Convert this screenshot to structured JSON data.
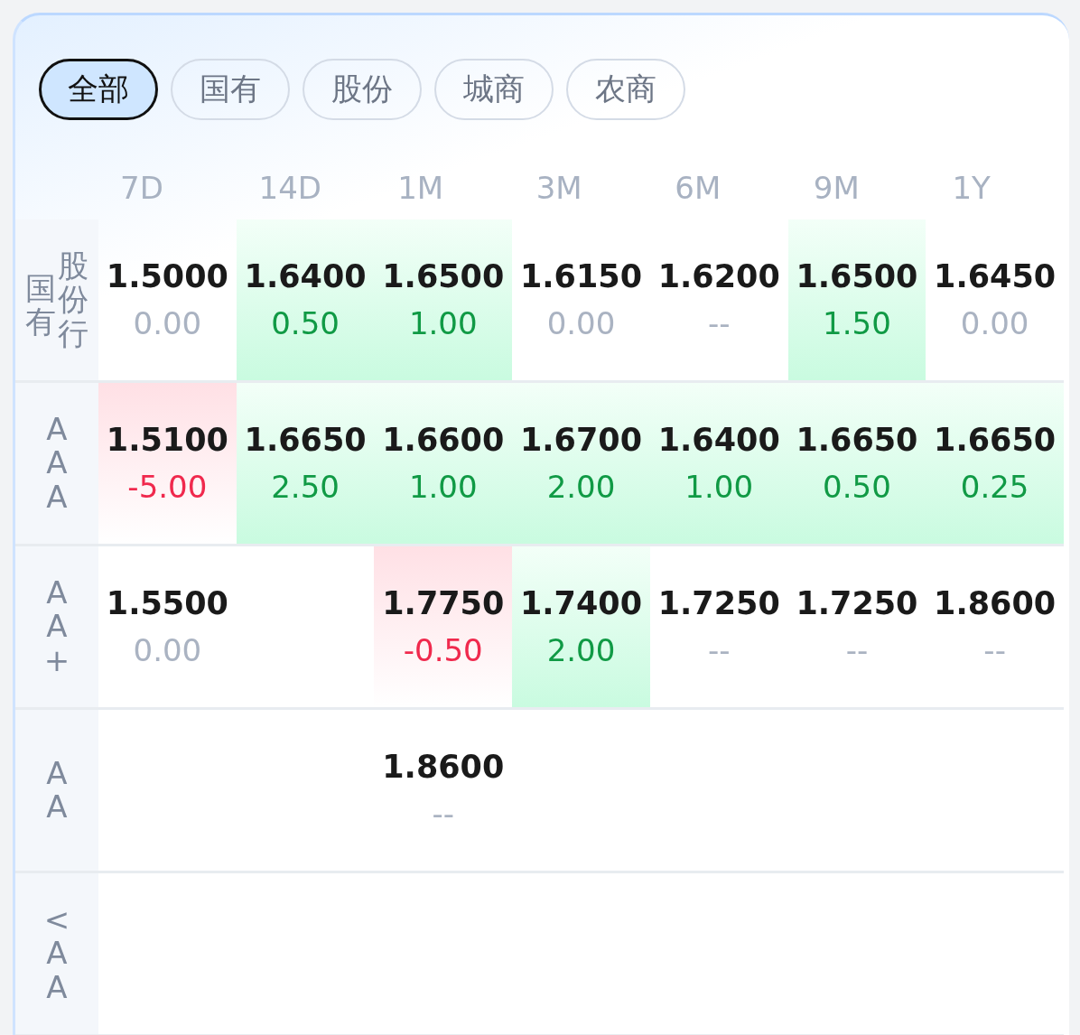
{
  "filters": [
    {
      "label": "全部",
      "selected": true
    },
    {
      "label": "国有",
      "selected": false
    },
    {
      "label": "股份",
      "selected": false
    },
    {
      "label": "城商",
      "selected": false
    },
    {
      "label": "农商",
      "selected": false
    }
  ],
  "columns": [
    "7D",
    "14D",
    "1M",
    "3M",
    "6M",
    "9M",
    "1Y"
  ],
  "rows": [
    {
      "label": [
        "国有",
        "股份行"
      ],
      "cells": [
        {
          "value": "1.5000",
          "change": "0.00",
          "up": false,
          "down": false
        },
        {
          "value": "1.6400",
          "change": "0.50",
          "up": true,
          "down": false
        },
        {
          "value": "1.6500",
          "change": "1.00",
          "up": true,
          "down": false
        },
        {
          "value": "1.6150",
          "change": "0.00",
          "up": false,
          "down": false
        },
        {
          "value": "1.6200",
          "change": "--",
          "up": false,
          "down": false
        },
        {
          "value": "1.6500",
          "change": "1.50",
          "up": true,
          "down": false
        },
        {
          "value": "1.6450",
          "change": "0.00",
          "up": false,
          "down": false
        }
      ]
    },
    {
      "label": [
        "AAA"
      ],
      "cells": [
        {
          "value": "1.5100",
          "change": "-5.00",
          "up": false,
          "down": true
        },
        {
          "value": "1.6650",
          "change": "2.50",
          "up": true,
          "down": false
        },
        {
          "value": "1.6600",
          "change": "1.00",
          "up": true,
          "down": false
        },
        {
          "value": "1.6700",
          "change": "2.00",
          "up": true,
          "down": false
        },
        {
          "value": "1.6400",
          "change": "1.00",
          "up": true,
          "down": false
        },
        {
          "value": "1.6650",
          "change": "0.50",
          "up": true,
          "down": false
        },
        {
          "value": "1.6650",
          "change": "0.25",
          "up": true,
          "down": false
        }
      ]
    },
    {
      "label": [
        "AA+"
      ],
      "cells": [
        {
          "value": "1.5500",
          "change": "0.00",
          "up": false,
          "down": false
        },
        null,
        {
          "value": "1.7750",
          "change": "-0.50",
          "up": false,
          "down": true
        },
        {
          "value": "1.7400",
          "change": "2.00",
          "up": true,
          "down": false
        },
        {
          "value": "1.7250",
          "change": "--",
          "up": false,
          "down": false
        },
        {
          "value": "1.7250",
          "change": "--",
          "up": false,
          "down": false
        },
        {
          "value": "1.8600",
          "change": "--",
          "up": false,
          "down": false
        }
      ]
    },
    {
      "label": [
        "AA"
      ],
      "cells": [
        null,
        null,
        {
          "value": "1.8600",
          "change": "--",
          "up": false,
          "down": false
        },
        null,
        null,
        null,
        null
      ]
    },
    {
      "label": [
        "<AA"
      ],
      "cells": [
        null,
        null,
        null,
        null,
        null,
        null,
        null
      ]
    }
  ]
}
